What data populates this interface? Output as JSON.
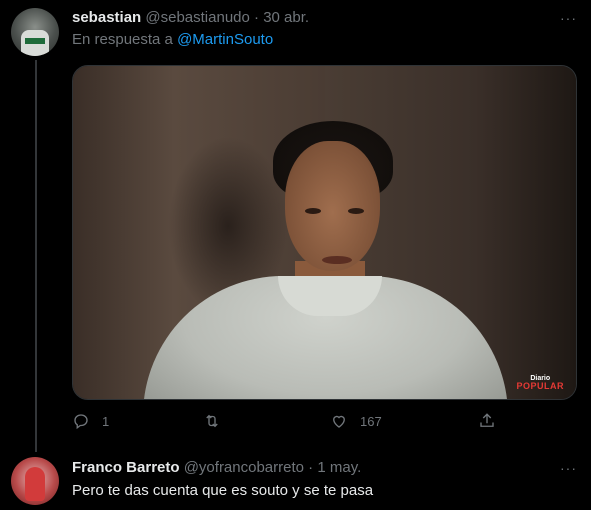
{
  "tweet1": {
    "name": "sebastian",
    "handle": "@sebastianudo",
    "separator": "·",
    "date": "30 abr.",
    "reply_prefix": "En respuesta a",
    "reply_mention": "@MartinSouto",
    "media_watermark": {
      "top": "Diario",
      "bottom": "POPULAR"
    },
    "actions": {
      "reply_icon": "reply-icon",
      "reply_count": "1",
      "retweet_icon": "retweet-icon",
      "retweet_count": "",
      "like_icon": "heart-icon",
      "like_count": "167",
      "share_icon": "share-icon"
    },
    "more_icon": "more-icon",
    "more_label": "···"
  },
  "tweet2": {
    "name": "Franco Barreto",
    "handle": "@yofrancobarreto",
    "separator": "·",
    "date": "1 may.",
    "text": "Pero te das cuenta que es souto y se te pasa",
    "more_icon": "more-icon",
    "more_label": "···"
  },
  "colors": {
    "background": "#000000",
    "text_primary": "#e7e9ea",
    "text_secondary": "#71767b",
    "link": "#1d9bf0",
    "border": "#2f3336",
    "watermark_red": "#e53935"
  }
}
